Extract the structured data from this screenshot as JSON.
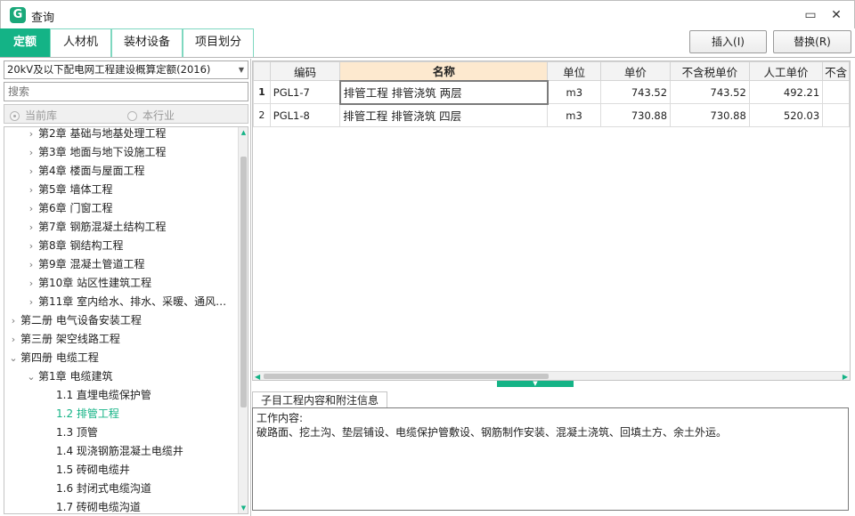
{
  "window": {
    "title": "查询",
    "icon_letter": "G",
    "maximize_glyph": "▭",
    "close_glyph": "✕"
  },
  "tabs": [
    {
      "label": "定额",
      "active": true
    },
    {
      "label": "人材机",
      "active": false
    },
    {
      "label": "装材设备",
      "active": false
    },
    {
      "label": "项目划分",
      "active": false
    }
  ],
  "actions": {
    "insert_label": "插入(I)",
    "replace_label": "替换(R)"
  },
  "left_panel": {
    "quota_library": "20kV及以下配电网工程建设概算定额(2016)",
    "search_placeholder": "搜索",
    "radio_current": "当前库",
    "radio_industry": "本行业",
    "tree": [
      {
        "label": "第2章 基础与地基处理工程",
        "level": 2,
        "state": "collapsed",
        "active": false
      },
      {
        "label": "第3章 地面与地下设施工程",
        "level": 2,
        "state": "collapsed",
        "active": false
      },
      {
        "label": "第4章 楼面与屋面工程",
        "level": 2,
        "state": "collapsed",
        "active": false
      },
      {
        "label": "第5章 墙体工程",
        "level": 2,
        "state": "collapsed",
        "active": false
      },
      {
        "label": "第6章 门窗工程",
        "level": 2,
        "state": "collapsed",
        "active": false
      },
      {
        "label": "第7章 钢筋混凝土结构工程",
        "level": 2,
        "state": "collapsed",
        "active": false
      },
      {
        "label": "第8章 钢结构工程",
        "level": 2,
        "state": "collapsed",
        "active": false
      },
      {
        "label": "第9章 混凝土管道工程",
        "level": 2,
        "state": "collapsed",
        "active": false
      },
      {
        "label": "第10章 站区性建筑工程",
        "level": 2,
        "state": "collapsed",
        "active": false
      },
      {
        "label": "第11章 室内给水、排水、采暖、通风…",
        "level": 2,
        "state": "collapsed",
        "active": false
      },
      {
        "label": "第二册 电气设备安装工程",
        "level": 1,
        "state": "collapsed",
        "active": false
      },
      {
        "label": "第三册 架空线路工程",
        "level": 1,
        "state": "collapsed",
        "active": false
      },
      {
        "label": "第四册 电缆工程",
        "level": 1,
        "state": "expanded",
        "active": false
      },
      {
        "label": "第1章 电缆建筑",
        "level": 2,
        "state": "expanded",
        "active": false
      },
      {
        "label": "1.1 直埋电缆保护管",
        "level": 3,
        "state": "leaf",
        "active": false
      },
      {
        "label": "1.2 排管工程",
        "level": 3,
        "state": "leaf",
        "active": true
      },
      {
        "label": "1.3 顶管",
        "level": 3,
        "state": "leaf",
        "active": false
      },
      {
        "label": "1.4 现浇钢筋混凝土电缆井",
        "level": 3,
        "state": "leaf",
        "active": false
      },
      {
        "label": "1.5 砖砌电缆井",
        "level": 3,
        "state": "leaf",
        "active": false
      },
      {
        "label": "1.6 封闭式电缆沟道",
        "level": 3,
        "state": "leaf",
        "active": false
      },
      {
        "label": "1.7 砖砌电缆沟道",
        "level": 3,
        "state": "leaf",
        "active": false
      }
    ]
  },
  "grid": {
    "columns": [
      "",
      "编码",
      "名称",
      "单位",
      "单价",
      "不含税单价",
      "人工单价",
      "不含"
    ],
    "rows": [
      {
        "num": "1",
        "code": "PGL1-7",
        "name": "排管工程 排管浇筑 两层",
        "unit": "m3",
        "price": "743.52",
        "price_ex_tax": "743.52",
        "labor_price": "492.21"
      },
      {
        "num": "2",
        "code": "PGL1-8",
        "name": "排管工程 排管浇筑 四层",
        "unit": "m3",
        "price": "730.88",
        "price_ex_tax": "730.88",
        "labor_price": "520.03"
      }
    ]
  },
  "detail": {
    "tab_label": "子目工程内容和附注信息",
    "heading": "工作内容:",
    "content": "破路面、挖土沟、垫层铺设、电缆保护管敷设、钢筋制作安装、混凝土浇筑、回填土方、余土外运。"
  },
  "colors": {
    "accent": "#14b386",
    "header_highlight": "#fde9cf"
  }
}
